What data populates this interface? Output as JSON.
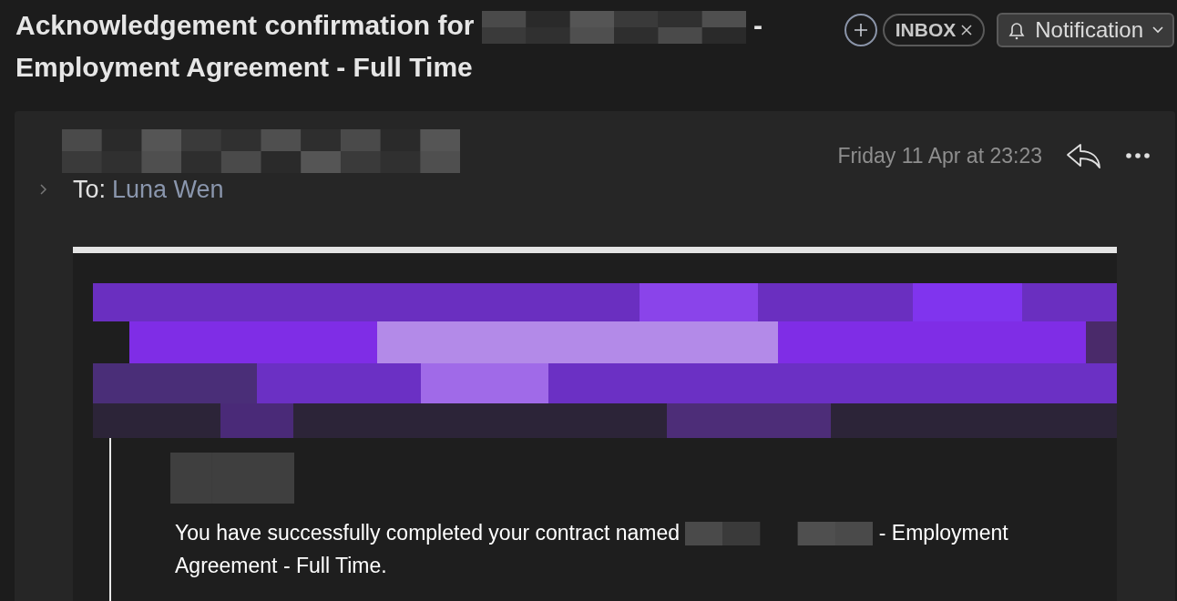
{
  "subject": {
    "before": "Acknowledgement confirmation for",
    "after": [
      "-",
      "Employment Agreement - Full Time"
    ]
  },
  "tag": {
    "label": "INBOX"
  },
  "notification_button": {
    "label": "Notification"
  },
  "message": {
    "date": "Friday 11 Apr at 23:23",
    "to_label": "To:",
    "to": "Luna Wen",
    "expanded": false,
    "body": {
      "before": "You have successfully completed your contract named",
      "after": [
        "- Employment",
        "Agreement - Full Time."
      ]
    }
  }
}
